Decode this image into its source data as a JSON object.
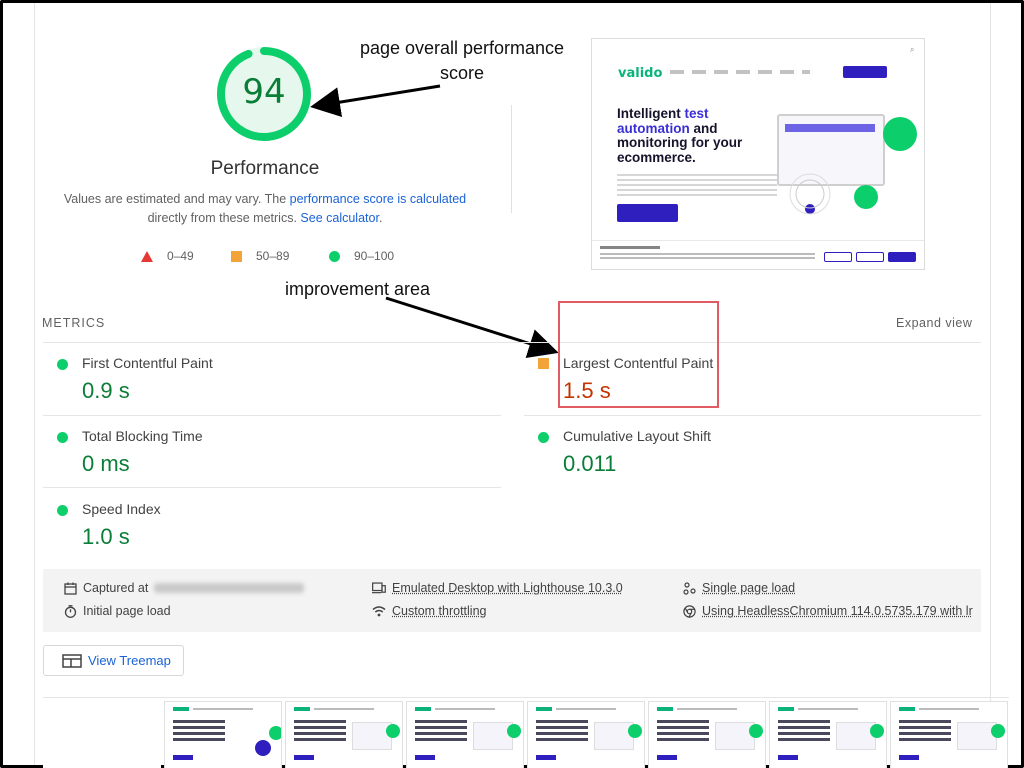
{
  "gauge": {
    "score": "94",
    "score_fraction": 0.94,
    "title": "Performance",
    "color": "#0cce6b"
  },
  "description": {
    "text_before": "Values are estimated and may vary. The ",
    "link1": "performance score is calculated",
    "text_middle": "directly from these metrics. ",
    "link2": "See calculator",
    "text_after": "."
  },
  "legend": {
    "fail": "0–49",
    "average": "50–89",
    "pass": "90–100"
  },
  "annotations": {
    "score": "page overall performance score",
    "improvement": "improvement area"
  },
  "preview": {
    "logo": "valido",
    "headline_1": "Intelligent ",
    "headline_hl": "test automation",
    "headline_2": " and monitoring for your ecommerce."
  },
  "metrics": {
    "title": "METRICS",
    "expand": "Expand view",
    "items": [
      {
        "label": "First Contentful Paint",
        "value": "0.9 s",
        "status": "pass"
      },
      {
        "label": "Largest Contentful Paint",
        "value": "1.5 s",
        "status": "average"
      },
      {
        "label": "Total Blocking Time",
        "value": "0 ms",
        "status": "pass"
      },
      {
        "label": "Cumulative Layout Shift",
        "value": "0.011",
        "status": "pass"
      },
      {
        "label": "Speed Index",
        "value": "1.0 s",
        "status": "pass"
      }
    ]
  },
  "info": {
    "captured": "Captured at",
    "initial_load": "Initial page load",
    "emulated": "Emulated Desktop with Lighthouse 10.3.0",
    "throttling": "Custom throttling",
    "single_page": "Single page load",
    "headless": "Using HeadlessChromium 114.0.5735.179 with lr"
  },
  "treemap": {
    "label": "View Treemap"
  },
  "colors": {
    "pass": "#0cce6b",
    "average": "#f2a33a",
    "fail": "#e53935",
    "link": "#1a62d6"
  }
}
